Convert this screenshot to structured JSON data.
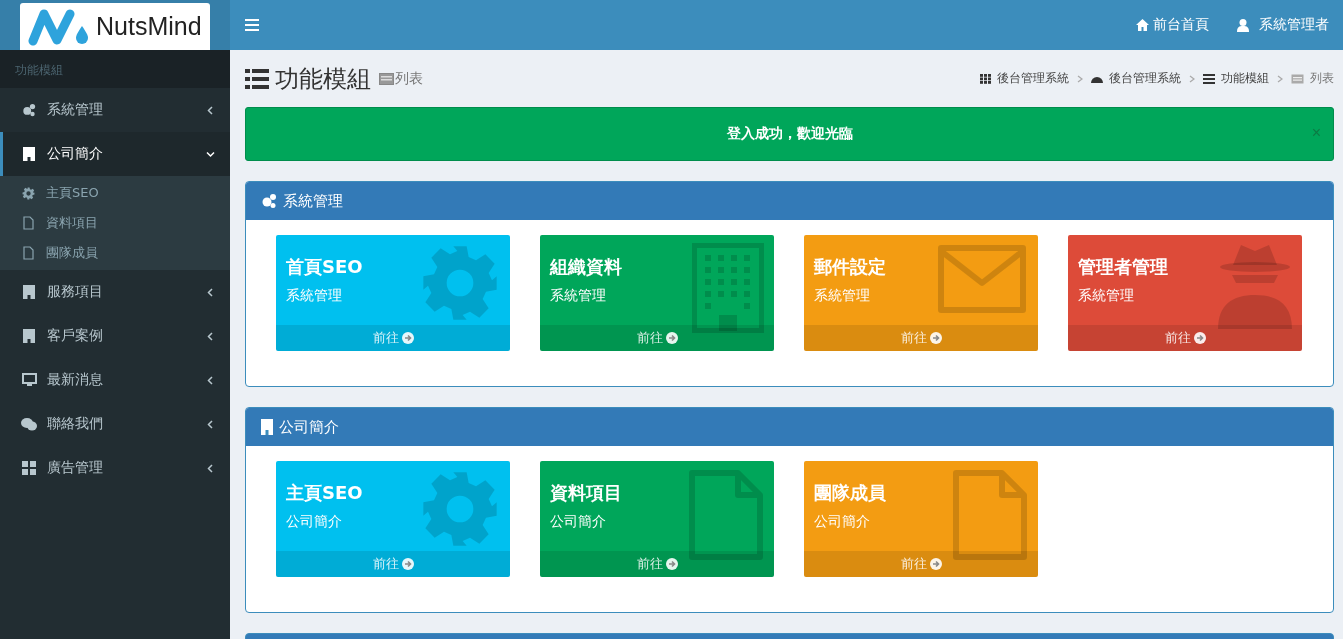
{
  "topbar": {
    "logo_text": "NutsMind",
    "links": [
      {
        "label": "前台首頁"
      },
      {
        "label": "系統管理者"
      }
    ]
  },
  "sidebar": {
    "header": "功能模組",
    "items": [
      {
        "label": "系統管理",
        "expanded": false
      },
      {
        "label": "公司簡介",
        "expanded": true,
        "children": [
          {
            "label": "主頁SEO"
          },
          {
            "label": "資料項目"
          },
          {
            "label": "團隊成員"
          }
        ]
      },
      {
        "label": "服務項目",
        "expanded": false
      },
      {
        "label": "客戶案例",
        "expanded": false
      },
      {
        "label": "最新消息",
        "expanded": false
      },
      {
        "label": "聯絡我們",
        "expanded": false
      },
      {
        "label": "廣告管理",
        "expanded": false
      }
    ]
  },
  "page_header": {
    "title": "功能模組",
    "subtitle": "列表"
  },
  "breadcrumb": [
    {
      "label": "後台管理系統"
    },
    {
      "label": "後台管理系統"
    },
    {
      "label": "功能模組"
    },
    {
      "label": "列表"
    }
  ],
  "alert": {
    "message": "登入成功，歡迎光臨",
    "close": "×"
  },
  "panels": [
    {
      "title": "系統管理",
      "tiles": [
        {
          "title": "首頁SEO",
          "subtitle": "系統管理",
          "link": "前往",
          "color": "#00c0ef"
        },
        {
          "title": "組織資料",
          "subtitle": "系統管理",
          "link": "前往",
          "color": "#00a65a"
        },
        {
          "title": "郵件設定",
          "subtitle": "系統管理",
          "link": "前往",
          "color": "#f39c12"
        },
        {
          "title": "管理者管理",
          "subtitle": "系統管理",
          "link": "前往",
          "color": "#dd4b39"
        }
      ]
    },
    {
      "title": "公司簡介",
      "tiles": [
        {
          "title": "主頁SEO",
          "subtitle": "公司簡介",
          "link": "前往",
          "color": "#00c0ef"
        },
        {
          "title": "資料項目",
          "subtitle": "公司簡介",
          "link": "前往",
          "color": "#00a65a"
        },
        {
          "title": "團隊成員",
          "subtitle": "公司簡介",
          "link": "前往",
          "color": "#f39c12"
        }
      ]
    }
  ]
}
